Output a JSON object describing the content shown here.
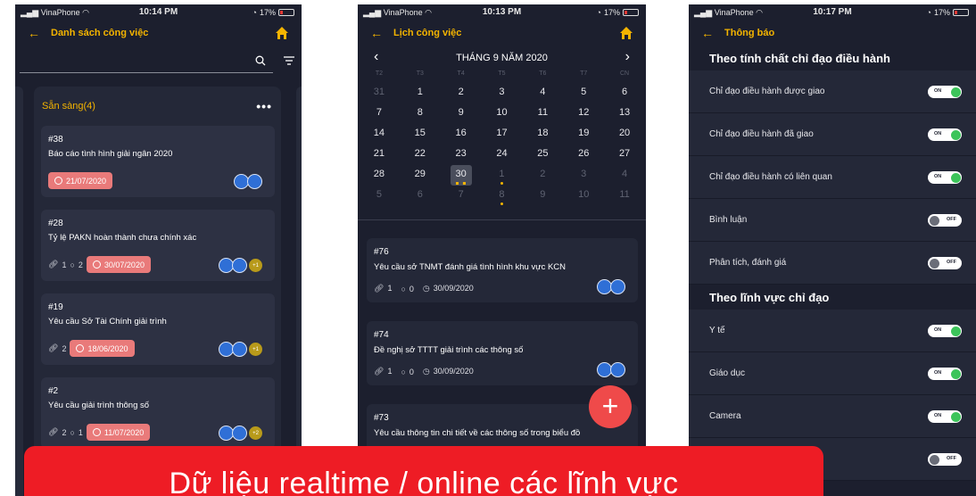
{
  "colors": {
    "accent": "#f4b400",
    "background": "#1c1f2e",
    "card": "#2d3143",
    "date_badge": "#e97a7a",
    "fab": "#ef4a4a",
    "toggle_on": "#3cc45a",
    "banner": "#ee1c25"
  },
  "phone1": {
    "status": {
      "carrier": "VinaPhone",
      "time": "10:14 PM",
      "battery": "17%"
    },
    "nav": {
      "title": "Danh sách công việc"
    },
    "column": {
      "title": "Sẵn sàng(4)",
      "cards": [
        {
          "id": "#38",
          "title": "Báo cáo tình hình giải ngân 2020",
          "attachments": "",
          "comments": "",
          "date": "21/07/2020",
          "extra": ""
        },
        {
          "id": "#28",
          "title": "Tỷ lệ PAKN hoàn thành chưa chính xác",
          "attachments": "1",
          "comments": "2",
          "date": "30/07/2020",
          "extra": "+1"
        },
        {
          "id": "#19",
          "title": "Yêu cầu Sở Tài Chính giải trình",
          "attachments": "2",
          "comments": "",
          "date": "18/06/2020",
          "extra": "+1"
        },
        {
          "id": "#2",
          "title": "Yêu cầu giải trình thông số",
          "attachments": "2",
          "comments": "1",
          "date": "11/07/2020",
          "extra": "+2"
        }
      ]
    }
  },
  "phone2": {
    "status": {
      "carrier": "VinaPhone",
      "time": "10:13 PM",
      "battery": "17%"
    },
    "nav": {
      "title": "Lịch công việc"
    },
    "calendar": {
      "month_label": "THÁNG 9 NĂM 2020",
      "weekdays": [
        "T2",
        "T3",
        "T4",
        "T5",
        "T6",
        "T7",
        "CN"
      ],
      "days": [
        {
          "d": "31",
          "dim": true
        },
        {
          "d": "1"
        },
        {
          "d": "2"
        },
        {
          "d": "3"
        },
        {
          "d": "4"
        },
        {
          "d": "5"
        },
        {
          "d": "6"
        },
        {
          "d": "7"
        },
        {
          "d": "8"
        },
        {
          "d": "9"
        },
        {
          "d": "10"
        },
        {
          "d": "11"
        },
        {
          "d": "12"
        },
        {
          "d": "13"
        },
        {
          "d": "14"
        },
        {
          "d": "15"
        },
        {
          "d": "16"
        },
        {
          "d": "17"
        },
        {
          "d": "18"
        },
        {
          "d": "19"
        },
        {
          "d": "20"
        },
        {
          "d": "21"
        },
        {
          "d": "22"
        },
        {
          "d": "23"
        },
        {
          "d": "24"
        },
        {
          "d": "25"
        },
        {
          "d": "26"
        },
        {
          "d": "27"
        },
        {
          "d": "28"
        },
        {
          "d": "29"
        },
        {
          "d": "30",
          "sel": true,
          "mark": "triple"
        },
        {
          "d": "1",
          "dim": true,
          "mark": "dot"
        },
        {
          "d": "2",
          "dim": true
        },
        {
          "d": "3",
          "dim": true
        },
        {
          "d": "4",
          "dim": true
        },
        {
          "d": "5",
          "dim": true
        },
        {
          "d": "6",
          "dim": true
        },
        {
          "d": "7",
          "dim": true
        },
        {
          "d": "8",
          "dim": true,
          "mark": "dot"
        },
        {
          "d": "9",
          "dim": true
        },
        {
          "d": "10",
          "dim": true
        },
        {
          "d": "11",
          "dim": true
        }
      ]
    },
    "tasks": [
      {
        "id": "#76",
        "title": "Yêu cầu sở TNMT đánh giá tình hình khu vực KCN",
        "attachments": "1",
        "comments": "0",
        "date": "30/09/2020"
      },
      {
        "id": "#74",
        "title": "Đề nghị sở TTTT giải trình các thông số",
        "attachments": "1",
        "comments": "0",
        "date": "30/09/2020"
      },
      {
        "id": "#73",
        "title": "Yêu cầu thông tin chi tiết về các thông số trong biểu đồ",
        "attachments": "",
        "comments": "",
        "date": ""
      }
    ],
    "fab_label": "+"
  },
  "phone3": {
    "status": {
      "carrier": "VinaPhone",
      "time": "10:17 PM",
      "battery": "17%"
    },
    "nav": {
      "title": "Thông báo"
    },
    "sections": [
      {
        "title": "Theo tính chất chỉ đạo điều hành",
        "items": [
          {
            "label": "Chỉ đạo điều hành được giao",
            "state": "ON"
          },
          {
            "label": "Chỉ đạo điều hành đã giao",
            "state": "ON"
          },
          {
            "label": "Chỉ đạo điều hành có liên quan",
            "state": "ON"
          },
          {
            "label": "Bình luận",
            "state": "OFF"
          },
          {
            "label": "Phân tích, đánh giá",
            "state": "OFF"
          }
        ]
      },
      {
        "title": "Theo lĩnh vực chỉ đạo",
        "items": [
          {
            "label": "Y tế",
            "state": "ON"
          },
          {
            "label": "Giáo dục",
            "state": "ON"
          },
          {
            "label": "Camera",
            "state": "ON"
          },
          {
            "label": "",
            "state": "OFF"
          }
        ]
      }
    ]
  },
  "banner": {
    "text": "Dữ liệu realtime / online các lĩnh vực"
  }
}
